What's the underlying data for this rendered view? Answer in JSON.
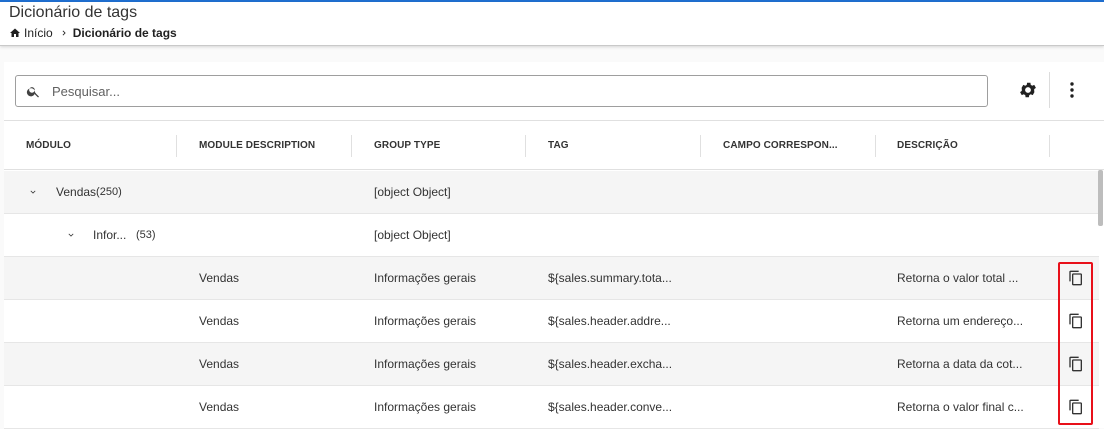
{
  "header": {
    "title": "Dicionário de tags",
    "breadcrumb": {
      "home": "Início",
      "current": "Dicionário de tags"
    }
  },
  "search": {
    "placeholder": "Pesquisar...",
    "value": ""
  },
  "table": {
    "columns": [
      "MÓDULO",
      "MODULE DESCRIPTION",
      "GROUP TYPE",
      "TAG",
      "CAMPO CORRESPON...",
      "DESCRIÇÃO"
    ],
    "group": {
      "label": "Vendas",
      "count": "(250)",
      "group_type": "[object Object]"
    },
    "subgroup": {
      "label": "Infor...",
      "count": "(53)",
      "group_type": "[object Object]"
    },
    "rows": [
      {
        "module_description": "Vendas",
        "group_type": "Informações gerais",
        "tag": "${sales.summary.tota...",
        "campo": "",
        "descricao": "Retorna o valor total ..."
      },
      {
        "module_description": "Vendas",
        "group_type": "Informações gerais",
        "tag": "${sales.header.addre...",
        "campo": "",
        "descricao": "Retorna um endereço..."
      },
      {
        "module_description": "Vendas",
        "group_type": "Informações gerais",
        "tag": "${sales.header.excha...",
        "campo": "",
        "descricao": "Retorna a data da cot..."
      },
      {
        "module_description": "Vendas",
        "group_type": "Informações gerais",
        "tag": "${sales.header.conve...",
        "campo": "",
        "descricao": "Retorna o valor final c..."
      }
    ]
  },
  "icons": {
    "home": "home-icon",
    "breadcrumb_separator": "chevron-right-icon",
    "search": "search-icon",
    "settings": "gear-icon",
    "more": "more-vertical-icon",
    "expand": "chevron-down-icon",
    "copy": "copy-icon"
  },
  "colors": {
    "accent_line": "#1f6fd1",
    "highlight_border": "#e8101a",
    "row_shaded": "#f5f5f5"
  }
}
